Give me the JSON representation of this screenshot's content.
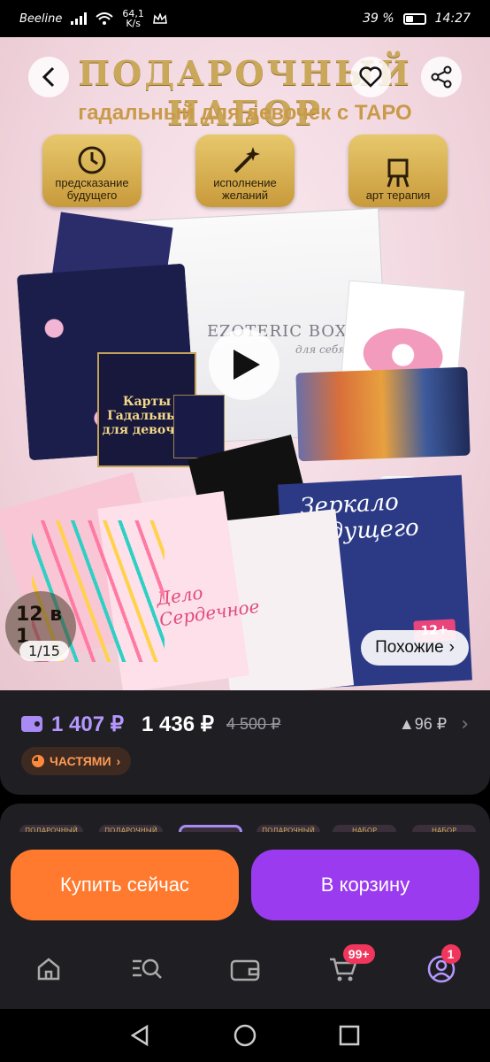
{
  "status_bar": {
    "carrier": "Beeline",
    "net_speed_value": "64,1",
    "net_speed_unit": "K/s",
    "battery_percent": "39 %",
    "battery_level": 0.39,
    "time": "14:27"
  },
  "hero": {
    "title": "ПОДАРОЧНЫЙ НАБОР",
    "subtitle": "гадальный для девочек с ТАРО",
    "badges": [
      {
        "label": "предсказание будущего",
        "icon": "clock-icon"
      },
      {
        "label": "исполнение желаний",
        "icon": "magic-wand-icon"
      },
      {
        "label": "арт терапия",
        "icon": "easel-icon"
      }
    ],
    "box_brand": "EZOTERIC BOX",
    "box_brand_sub": "для себя",
    "tarot_box_title": "Карты Гадальные для девочек",
    "book_future_title": "Зеркало будущего",
    "book_age": "12+",
    "book_heart_title": "Дело Сердечное",
    "counter_corner": "12 в 1",
    "image_counter": "1/15",
    "similar_label": "Похожие"
  },
  "price": {
    "wallet_price": "1 407 ₽",
    "current_price": "1 436 ₽",
    "old_price": "4 500 ₽",
    "bonus": "▲96 ₽",
    "installment_label": "ЧАСТЯМИ"
  },
  "thumbnails": [
    {
      "label": "ПОДАРОЧНЫЙ НАБОР"
    },
    {
      "label": "ПОДАРОЧНЫЙ НАБОР"
    },
    {
      "label": ""
    },
    {
      "label": "ПОДАРОЧНЫЙ НАБОР"
    },
    {
      "label": "НАБОР"
    },
    {
      "label": "НАБОР"
    }
  ],
  "actions": {
    "buy_now": "Купить сейчас",
    "add_to_cart": "В корзину"
  },
  "bottom_nav": {
    "cart_badge": "99+",
    "profile_badge": "1"
  },
  "colors": {
    "accent_purple": "#9b3bf0",
    "buy_orange": "#ff7a2e",
    "wallet_price": "#b598ff",
    "gold": "#caa85a"
  }
}
